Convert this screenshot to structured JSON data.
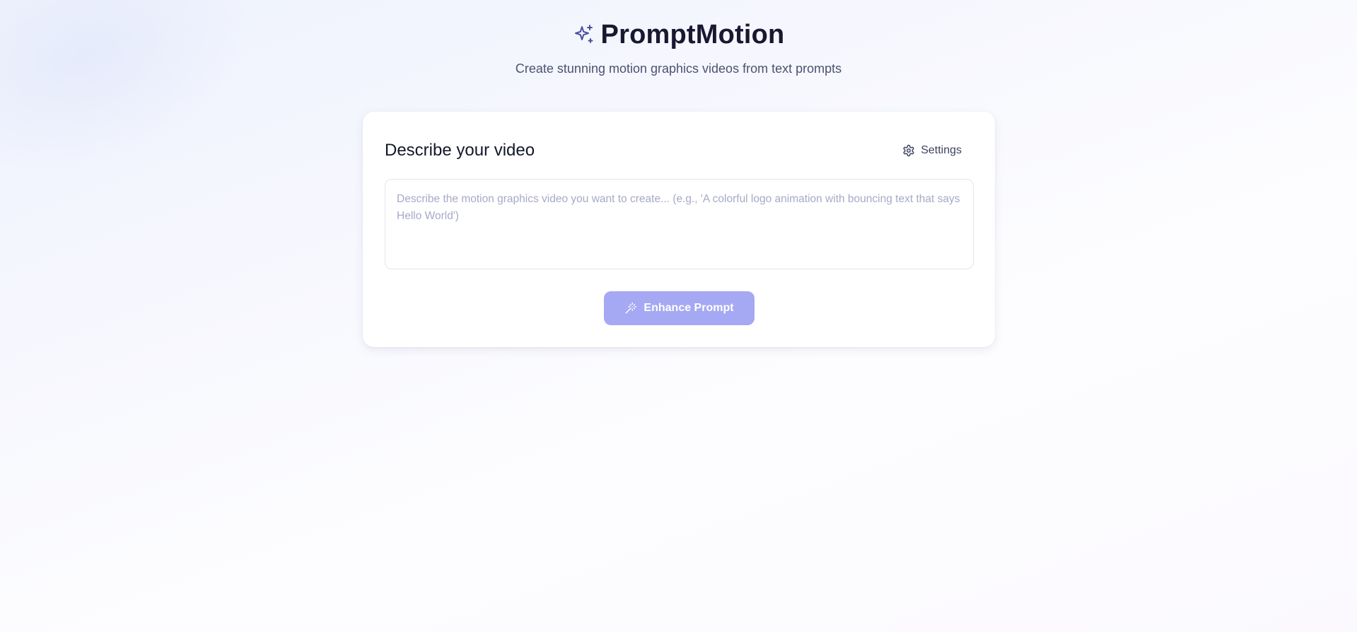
{
  "app": {
    "title": "PromptMotion",
    "subtitle": "Create stunning motion graphics videos from text prompts",
    "brand_icon": "sparkles-icon"
  },
  "card": {
    "title": "Describe your video",
    "settings_label": "Settings",
    "settings_icon": "gear-icon",
    "prompt": {
      "value": "",
      "placeholder": "Describe the motion graphics video you want to create... (e.g., 'A colorful logo animation with bouncing text that says Hello World')"
    },
    "enhance_label": "Enhance Prompt",
    "enhance_icon": "magic-wand-icon"
  },
  "colors": {
    "accent": "#a5a8f2",
    "brand_icon": "#4a4f9e",
    "title_text": "#1a1730"
  }
}
